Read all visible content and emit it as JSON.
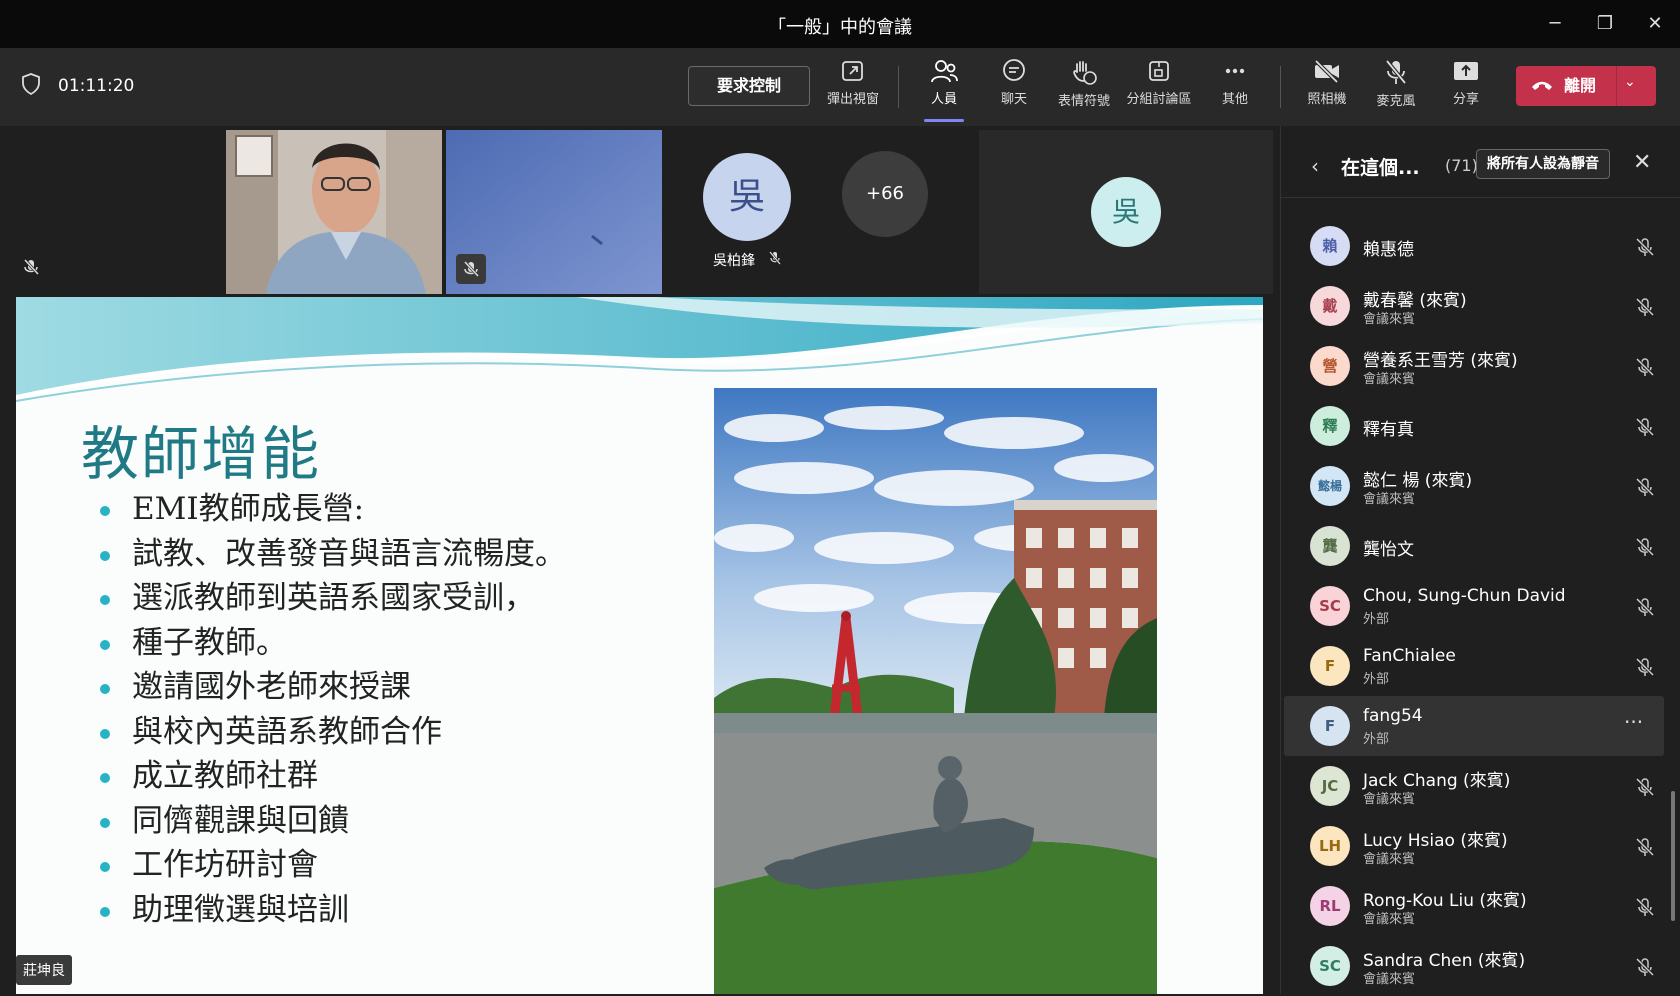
{
  "window": {
    "title": "「一般」中的會議",
    "minimize": "─",
    "maximize": "❐",
    "close": "✕"
  },
  "toolbar": {
    "timer": "01:11:20",
    "request_control": "要求控制",
    "popout": "彈出視窗",
    "people": "人員",
    "chat": "聊天",
    "reactions": "表情符號",
    "breakout": "分組討論區",
    "more": "其他",
    "camera": "照相機",
    "mic": "麥克風",
    "share": "分享",
    "leave": "離開",
    "leave_caret": "⌄"
  },
  "video": {
    "tile3_initial": "吳",
    "tile3_name": "吳柏鋒",
    "overflow_count": "+66",
    "tile5_initial": "吳"
  },
  "slide": {
    "title": "教師增能",
    "bullets": [
      "EMI教師成長營:",
      "試教、改善發音與語言流暢度。",
      "選派教師到英語系國家受訓，",
      "種子教師。",
      "邀請國外老師來授課",
      "與校內英語系教師合作",
      "成立教師社群",
      "同儕觀課與回饋",
      "工作坊研討會",
      "助理徵選與培訓"
    ],
    "presenter": "莊坤良"
  },
  "panel": {
    "back": "‹",
    "title": "在這個...",
    "count": "(71)",
    "mute_all": "將所有人設為靜音",
    "close": "✕",
    "participants": [
      {
        "initials": "賴",
        "name": "賴惠德",
        "sub": "",
        "bg": "#d7dcf5",
        "fg": "#4f5fa8"
      },
      {
        "initials": "戴",
        "name": "戴春馨 (來賓)",
        "sub": "會議來賓",
        "bg": "#f7d9dc",
        "fg": "#a8404f"
      },
      {
        "initials": "營",
        "name": "營養系王雪芳 (來賓)",
        "sub": "會議來賓",
        "bg": "#fbd9cc",
        "fg": "#b5552e"
      },
      {
        "initials": "釋",
        "name": "釋有真",
        "sub": "",
        "bg": "#cdeedd",
        "fg": "#2e7d55"
      },
      {
        "initials": "懿楊",
        "name": "懿仁 楊 (來賓)",
        "sub": "會議來賓",
        "bg": "#d3e6f5",
        "fg": "#3b6e99"
      },
      {
        "initials": "龔",
        "name": "龔怡文",
        "sub": "",
        "bg": "#d9e3d3",
        "fg": "#556b45"
      },
      {
        "initials": "SC",
        "name": "Chou, Sung-Chun David",
        "sub": "外部",
        "bg": "#f9d3d8",
        "fg": "#a33b4c"
      },
      {
        "initials": "F",
        "name": "FanChialee",
        "sub": "外部",
        "bg": "#fbe6c0",
        "fg": "#9a6a13"
      },
      {
        "initials": "F",
        "name": "fang54",
        "sub": "外部",
        "bg": "#d6e3f0",
        "fg": "#3f5f80"
      },
      {
        "initials": "JC",
        "name": "Jack Chang (來賓)",
        "sub": "會議來賓",
        "bg": "#dde5d3",
        "fg": "#556b45"
      },
      {
        "initials": "LH",
        "name": "Lucy Hsiao (來賓)",
        "sub": "會議來賓",
        "bg": "#fbe6c0",
        "fg": "#9a6a13"
      },
      {
        "initials": "RL",
        "name": "Rong-Kou Liu (來賓)",
        "sub": "會議來賓",
        "bg": "#f5d3e6",
        "fg": "#9c3a72"
      },
      {
        "initials": "SC",
        "name": "Sandra Chen (來賓)",
        "sub": "會議來賓",
        "bg": "#d3eee5",
        "fg": "#2e7d66"
      }
    ],
    "more_dots": "···"
  }
}
